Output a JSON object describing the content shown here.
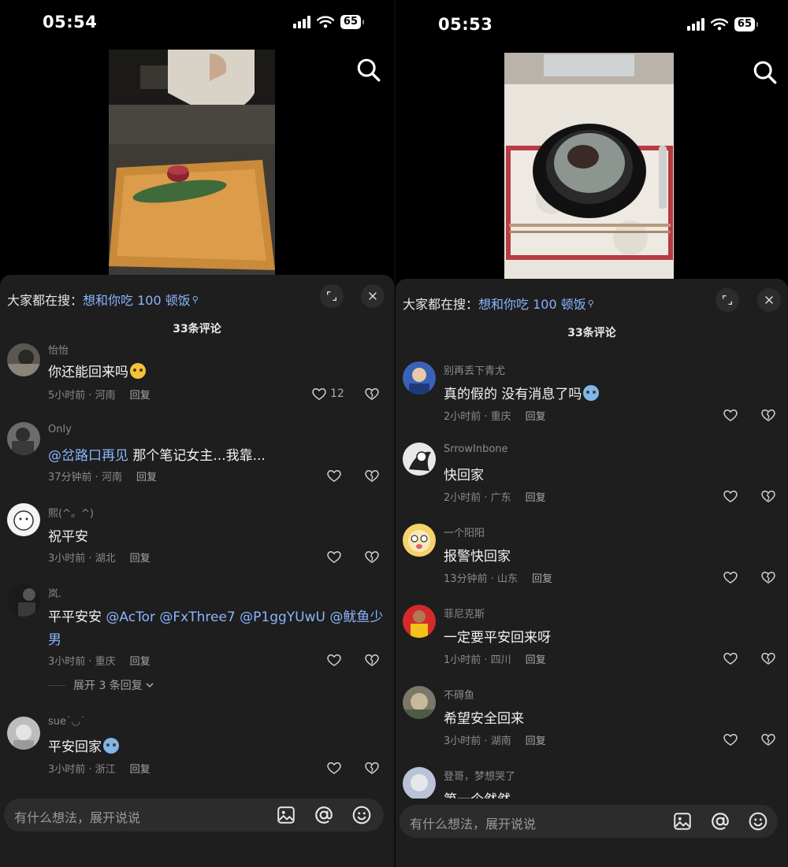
{
  "left": {
    "status_time": "05:54",
    "battery": "65",
    "hot_search": {
      "prefix": "大家都在搜：",
      "query": "想和你吃 100 顿饭"
    },
    "comment_count": "33条评论",
    "comments": [
      {
        "user": "怡怡",
        "text": "你还能回来吗",
        "emoji": true,
        "time": "5小时前 · 河南",
        "reply": "回复",
        "likes": "12"
      },
      {
        "user": "Only",
        "mention": "@岔路口再见",
        "text": " 那个笔记女主...我靠...",
        "time": "37分钟前 · 河南",
        "reply": "回复",
        "likes": ""
      },
      {
        "user": "熙(^。^)",
        "text": "祝平安",
        "time": "3小时前 · 湖北",
        "reply": "回复",
        "likes": ""
      },
      {
        "user": "岚.",
        "text": "平平安安",
        "mentions_line1": "@AcTor @FxThree7 @P1ggYUwU @鱿鱼少",
        "mentions_line2": "男",
        "time": "3小时前 · 重庆",
        "reply": "回复",
        "likes": ""
      },
      {
        "user": "sue˙◡˙",
        "text": "平安回家",
        "emoji": true,
        "time": "3小时前 · 浙江",
        "reply": "回复",
        "likes": ""
      }
    ],
    "expand_replies": "展开 3 条回复",
    "input_placeholder": "有什么想法，展开说说"
  },
  "right": {
    "status_time": "05:53",
    "battery": "65",
    "hot_search": {
      "prefix": "大家都在搜：",
      "query": "想和你吃 100 顿饭"
    },
    "comment_count": "33条评论",
    "comments": [
      {
        "user": "别再丢下青尤",
        "text": "真的假的  没有消息了吗",
        "emoji": true,
        "time": "2小时前 · 重庆",
        "reply": "回复"
      },
      {
        "user": "SrrowInbone",
        "text": "快回家",
        "time": "2小时前 · 广东",
        "reply": "回复"
      },
      {
        "user": "一个阳阳",
        "text": "报警快回家",
        "time": "13分钟前 · 山东",
        "reply": "回复"
      },
      {
        "user": "菲尼克斯",
        "text": "一定要平安回来呀",
        "time": "1小时前 · 四川",
        "reply": "回复"
      },
      {
        "user": "不碍鱼",
        "text": "希望安全回来",
        "time": "3小时前 · 湖南",
        "reply": "回复"
      },
      {
        "user": "登哥，梦想哭了",
        "text": "第一个然然"
      }
    ],
    "input_placeholder": "有什么想法，展开说说"
  },
  "colors": {
    "link": "#8ab4ff",
    "sheet_bg": "#1e1e1e",
    "muted": "#8a8a8a"
  },
  "icons": [
    "search-icon",
    "expand-icon",
    "close-icon",
    "heart-icon",
    "broken-heart-icon",
    "image-icon",
    "at-icon",
    "emoji-icon",
    "chevron-down-icon"
  ]
}
